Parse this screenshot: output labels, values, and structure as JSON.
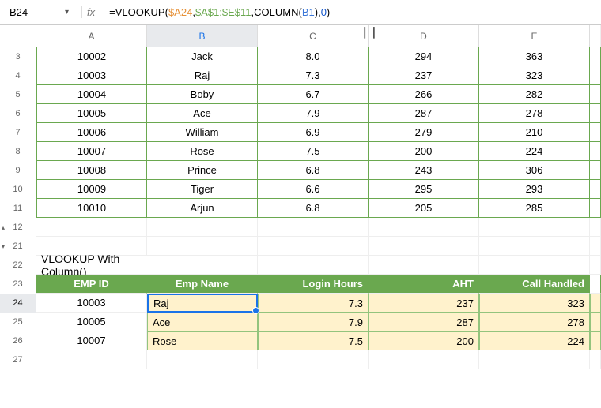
{
  "formula_bar": {
    "cell_ref": "B24",
    "fx_label": "fx",
    "parts": {
      "p1": "=VLOOKUP(",
      "ref1": "$A24",
      "c1": ",",
      "ref2": "$A$1:$E$11",
      "c2": ",COLUMN(",
      "ref3": "B1",
      "c3": "),",
      "num": "0",
      "c4": ")"
    }
  },
  "columns": [
    "A",
    "B",
    "C",
    "D",
    "E"
  ],
  "visible_rows": [
    "3",
    "4",
    "5",
    "6",
    "7",
    "8",
    "9",
    "10",
    "11",
    "12",
    "21",
    "22",
    "23",
    "24",
    "25",
    "26",
    "27"
  ],
  "data_rows": [
    {
      "a": "10002",
      "b": "Jack",
      "c": "8.0",
      "d": "294",
      "e": "363"
    },
    {
      "a": "10003",
      "b": "Raj",
      "c": "7.3",
      "d": "237",
      "e": "323"
    },
    {
      "a": "10004",
      "b": "Boby",
      "c": "6.7",
      "d": "266",
      "e": "282"
    },
    {
      "a": "10005",
      "b": "Ace",
      "c": "7.9",
      "d": "287",
      "e": "278"
    },
    {
      "a": "10006",
      "b": "William",
      "c": "6.9",
      "d": "279",
      "e": "210"
    },
    {
      "a": "10007",
      "b": "Rose",
      "c": "7.5",
      "d": "200",
      "e": "224"
    },
    {
      "a": "10008",
      "b": "Prince",
      "c": "6.8",
      "d": "243",
      "e": "306"
    },
    {
      "a": "10009",
      "b": "Tiger",
      "c": "6.6",
      "d": "295",
      "e": "293"
    },
    {
      "a": "10010",
      "b": "Arjun",
      "c": "6.8",
      "d": "205",
      "e": "285"
    }
  ],
  "section_title": "VLOOKUP With Column()",
  "result_headers": {
    "a": "EMP ID",
    "b": "Emp Name",
    "c": "Login Hours",
    "d": "AHT",
    "e": "Call Handled"
  },
  "result_rows": [
    {
      "a": "10003",
      "b": "Raj",
      "c": "7.3",
      "d": "237",
      "e": "323"
    },
    {
      "a": "10005",
      "b": "Ace",
      "c": "7.9",
      "d": "287",
      "e": "278"
    },
    {
      "a": "10007",
      "b": "Rose",
      "c": "7.5",
      "d": "200",
      "e": "224"
    }
  ],
  "collapse_marks": {
    "up": "▴",
    "down": "▾"
  },
  "hidden_cols_mark": "❘ ❘"
}
